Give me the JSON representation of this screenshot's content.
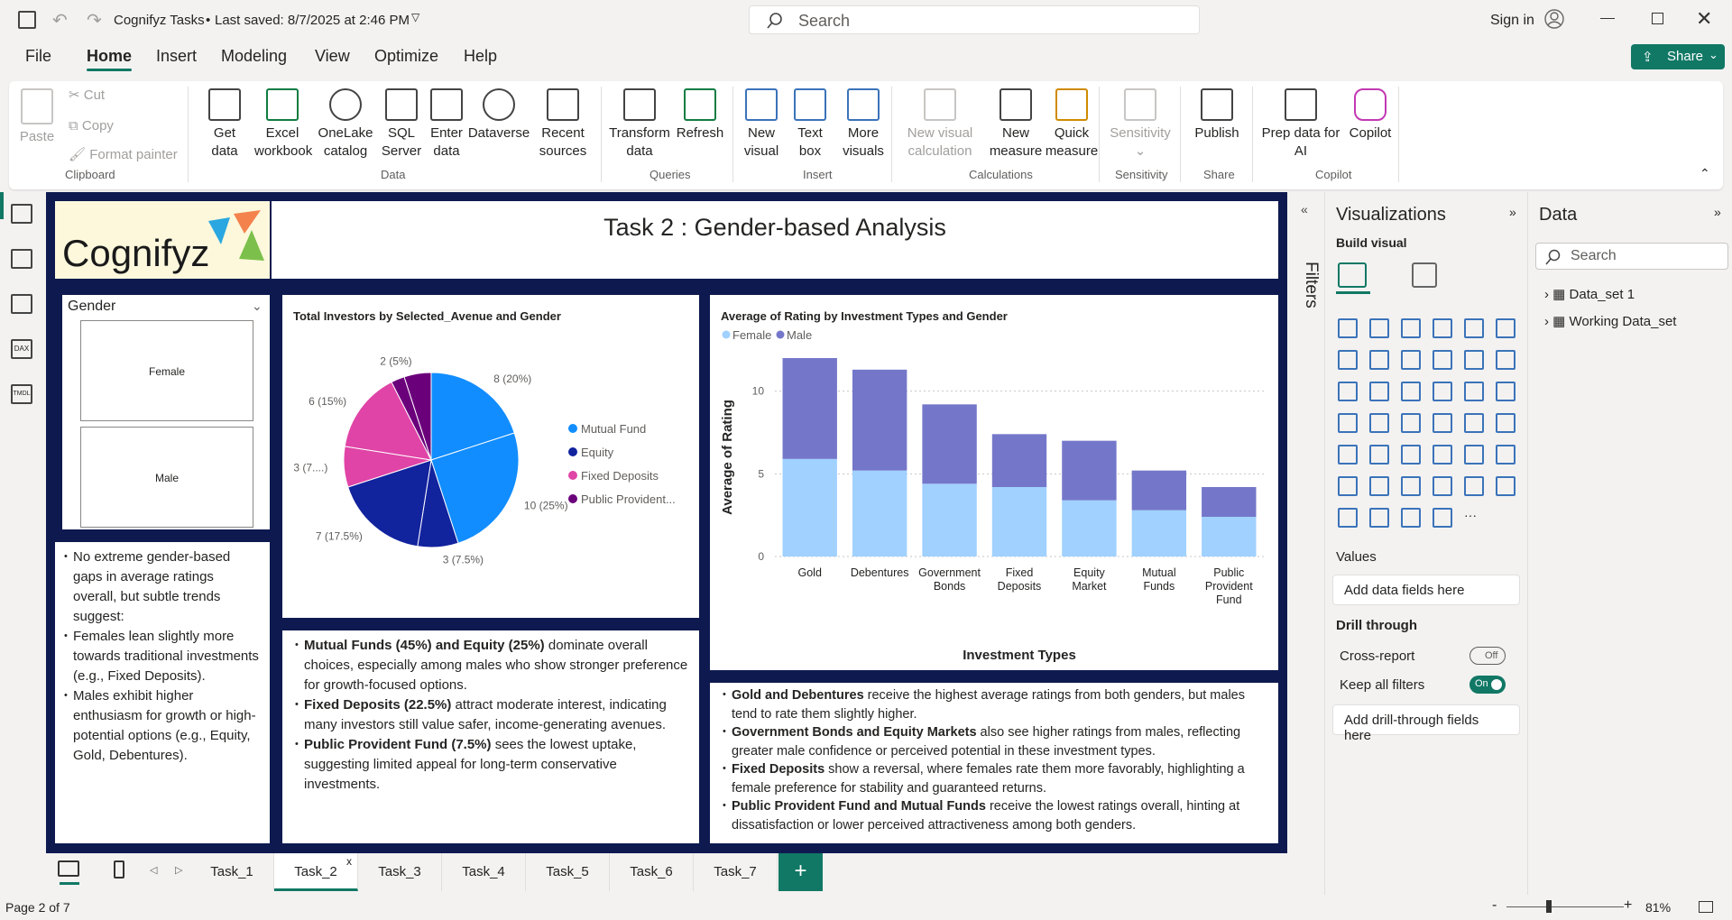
{
  "window": {
    "title": "Cognifyz Tasks",
    "saved": "Last saved: 8/7/2025 at 2:46 PM",
    "search_placeholder": "Search",
    "sign_in": "Sign in"
  },
  "menu": {
    "file": "File",
    "home": "Home",
    "insert": "Insert",
    "modeling": "Modeling",
    "view": "View",
    "optimize": "Optimize",
    "help": "Help",
    "share": "Share"
  },
  "ribbon": {
    "paste": "Paste",
    "cut": "Cut",
    "copy": "Copy",
    "format_painter": "Format painter",
    "clipboard": "Clipboard",
    "get_data": [
      "Get",
      "data"
    ],
    "excel": [
      "Excel",
      "workbook"
    ],
    "onelake": [
      "OneLake",
      "catalog"
    ],
    "sql": [
      "SQL",
      "Server"
    ],
    "enter": [
      "Enter",
      "data"
    ],
    "dataverse": "Dataverse",
    "recent": [
      "Recent",
      "sources"
    ],
    "data_group": "Data",
    "transform": [
      "Transform",
      "data"
    ],
    "refresh": "Refresh",
    "queries": "Queries",
    "new_visual": [
      "New",
      "visual"
    ],
    "text_box": [
      "Text",
      "box"
    ],
    "more_visuals": [
      "More",
      "visuals"
    ],
    "insert_group": "Insert",
    "new_calc": [
      "New visual",
      "calculation"
    ],
    "new_measure": [
      "New",
      "measure"
    ],
    "quick_measure": [
      "Quick",
      "measure"
    ],
    "calculations": "Calculations",
    "sensitivity": "Sensitivity",
    "sensitivity_group": "Sensitivity",
    "publish": "Publish",
    "share_group": "Share",
    "prep": [
      "Prep data for",
      "AI"
    ],
    "copilot": "Copilot",
    "copilot_group": "Copilot"
  },
  "report": {
    "logo_text": "Cognifyz",
    "title": "Task 2 :  Gender-based Analysis",
    "slicer": {
      "title": "Gender",
      "options": [
        "Female",
        "Male"
      ]
    },
    "pie_title": "Total Investors by Selected_Avenue and Gender",
    "bar_title": "Average of Rating by Investment Types and Gender"
  },
  "chart_data": [
    {
      "type": "pie",
      "title": "Total Investors by Selected_Avenue and Gender",
      "slices": [
        {
          "label": "8 (20%)",
          "value": 8,
          "color": "#118dff"
        },
        {
          "label": "10 (25%)",
          "value": 10,
          "color": "#118dff"
        },
        {
          "label": "3 (7.5%)",
          "value": 3,
          "color": "#12239e"
        },
        {
          "label": "7 (17.5%)",
          "value": 7,
          "color": "#12239e"
        },
        {
          "label": "3 (7....)",
          "value": 3,
          "color": "#e044a7"
        },
        {
          "label": "6 (15%)",
          "value": 6,
          "color": "#e044a7"
        },
        {
          "label": "",
          "value": 1,
          "color": "#6b007b"
        },
        {
          "label": "2 (5%)",
          "value": 2,
          "color": "#6b007b"
        }
      ],
      "legend": [
        {
          "name": "Mutual Fund",
          "color": "#118dff"
        },
        {
          "name": "Equity",
          "color": "#12239e"
        },
        {
          "name": "Fixed Deposits",
          "color": "#e044a7"
        },
        {
          "name": "Public Provident...",
          "color": "#6b007b"
        }
      ]
    },
    {
      "type": "bar",
      "stacked": true,
      "title": "Average of Rating by Investment Types and Gender",
      "xlabel": "Investment Types",
      "ylabel": "Average of Rating",
      "ylim": [
        0,
        12
      ],
      "yticks": [
        0,
        5,
        10
      ],
      "categories": [
        "Gold",
        "Debentures",
        "Government Bonds",
        "Fixed Deposits",
        "Equity Market",
        "Mutual Funds",
        "Public Provident Fund"
      ],
      "series": [
        {
          "name": "Female",
          "color": "#a0d1ff",
          "values": [
            5.9,
            5.2,
            4.4,
            4.2,
            3.4,
            2.8,
            2.4
          ]
        },
        {
          "name": "Male",
          "color": "#7477c9",
          "values": [
            6.1,
            6.1,
            4.8,
            3.2,
            3.6,
            2.4,
            1.8
          ]
        }
      ],
      "legend_position": "top-left"
    }
  ],
  "insights": {
    "gender": [
      {
        "plain": "No extreme gender-based gaps in average ratings overall, but subtle trends suggest:"
      },
      {
        "plain": "Females lean slightly more towards traditional investments (e.g., Fixed Deposits)."
      },
      {
        "plain": "Males exhibit higher enthusiasm for growth or high-potential options (e.g., Equity, Gold, Debentures)."
      }
    ],
    "pie": [
      {
        "bold": "Mutual Funds (45%) and Equity (25%)",
        "plain": " dominate overall choices, especially among males who show stronger preference for growth-focused options."
      },
      {
        "bold": "Fixed Deposits (22.5%)",
        "plain": " attract moderate interest, indicating many investors still value safer, income-generating avenues."
      },
      {
        "bold": "Public Provident Fund (7.5%)",
        "plain": " sees the lowest uptake, suggesting limited appeal for long-term conservative investments."
      }
    ],
    "bar": [
      {
        "bold": "Gold and Debentures",
        "plain": " receive the highest average ratings from both genders, but males tend to rate them slightly higher."
      },
      {
        "bold": "Government Bonds and Equity Markets",
        "plain": " also see higher ratings from males, reflecting greater male confidence or perceived potential in these investment types."
      },
      {
        "bold": "Fixed Deposits",
        "plain": " show a reversal, where females rate them more favorably, highlighting a female preference for stability and guaranteed returns."
      },
      {
        "bold": "Public Provident Fund and Mutual Funds",
        "plain": " receive the lowest ratings overall, hinting at dissatisfaction or lower perceived attractiveness among both genders."
      }
    ]
  },
  "filters": {
    "label": "Filters"
  },
  "visualizations": {
    "title": "Visualizations",
    "build": "Build visual",
    "values": "Values",
    "add_fields": "Add data fields here",
    "drill": "Drill through",
    "cross": "Cross-report",
    "off": "Off",
    "keep": "Keep all filters",
    "on": "On",
    "add_drill": "Add drill-through fields here"
  },
  "data_pane": {
    "title": "Data",
    "search": "Search",
    "tables": [
      "Data_set 1",
      "Working Data_set"
    ]
  },
  "tabs": [
    "Task_1",
    "Task_2",
    "Task_3",
    "Task_4",
    "Task_5",
    "Task_6",
    "Task_7"
  ],
  "tab_close": "x",
  "status": {
    "page": "Page 2 of 7",
    "zoom": "81%"
  }
}
